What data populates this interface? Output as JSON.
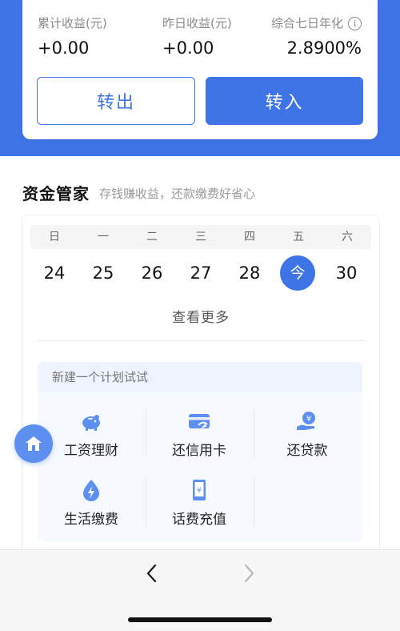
{
  "summary": {
    "cumulative_label": "累计收益(元)",
    "cumulative_value": "+0.00",
    "yesterday_label": "昨日收益(元)",
    "yesterday_value": "+0.00",
    "seven_day_label": "综合七日年化",
    "seven_day_value": "2.8900%",
    "transfer_out_label": "转出",
    "transfer_in_label": "转入"
  },
  "section": {
    "title": "资金管家",
    "subtitle": "存钱赚收益，还款缴费好省心"
  },
  "calendar": {
    "weekdays": [
      "日",
      "一",
      "二",
      "三",
      "四",
      "五",
      "六"
    ],
    "days": [
      "24",
      "25",
      "26",
      "27",
      "28",
      "今",
      "30"
    ],
    "today_index": 5,
    "see_more": "查看更多"
  },
  "plan": {
    "header": "新建一个计划试试",
    "items": [
      {
        "label": "工资理财",
        "icon": "piggy-bank-icon"
      },
      {
        "label": "还信用卡",
        "icon": "credit-card-icon"
      },
      {
        "label": "还贷款",
        "icon": "loan-hand-icon"
      },
      {
        "label": "生活缴费",
        "icon": "utility-bolt-icon"
      },
      {
        "label": "话费充值",
        "icon": "phone-recharge-icon"
      }
    ]
  },
  "colors": {
    "accent": "#3e74e6",
    "icon_blue": "#5d8ff0"
  }
}
